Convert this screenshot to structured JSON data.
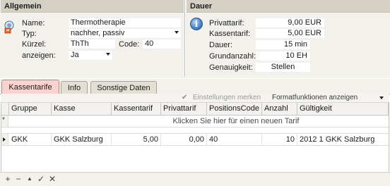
{
  "allgemein": {
    "title": "Allgemein",
    "name_label": "Name:",
    "name_value": "Thermotherapie",
    "typ_label": "Typ:",
    "typ_value": "nachher, passiv",
    "kuerzel_label": "Kürzel:",
    "kuerzel_value": "ThTh",
    "code_label": "Code:",
    "code_value": "40",
    "anzeigen_label": "anzeigen:",
    "anzeigen_value": "Ja"
  },
  "dauer": {
    "title": "Dauer",
    "privattarif_label": "Privattarif:",
    "privattarif_value": "9,00 EUR",
    "kassentarif_label": "Kassentarif:",
    "kassentarif_value": "5,00 EUR",
    "dauer_label": "Dauer:",
    "dauer_value": "15 min",
    "grundanzahl_label": "Grundanzahl:",
    "grundanzahl_value": "10 EH",
    "genauigkeit_label": "Genauigkeit:",
    "genauigkeit_value": "Stellen"
  },
  "tabs": [
    {
      "label": "Kassentarife",
      "active": true
    },
    {
      "label": "Info",
      "active": false
    },
    {
      "label": "Sonstige Daten",
      "active": false
    }
  ],
  "toolbar": {
    "settings_label": "Einstellungen merken",
    "format_label": "Formatfunktionen anzeigen"
  },
  "grid": {
    "columns": [
      "Gruppe",
      "Kasse",
      "Kassentarif",
      "Privattarif",
      "PositionsCode",
      "Anzahl",
      "Gültigkeit"
    ],
    "new_row_text": "Klicken Sie hier für einen neuen Tarif",
    "rows": [
      {
        "gruppe": "GKK",
        "kasse": "GKK Salzburg",
        "kassentarif": "5,00",
        "privattarif": "0,00",
        "positionscode": "40",
        "anzahl": "10",
        "gueltigkeit": "2012 1 GKK Salzburg"
      }
    ]
  },
  "navigator": {
    "add": "+",
    "remove": "−",
    "up": "▲",
    "confirm": "✓",
    "cancel": "✕"
  },
  "colors": {
    "header_bg": "#d5d0c4",
    "panel_bg": "#f3f1eb",
    "active_tab": "#f9d3d0"
  }
}
